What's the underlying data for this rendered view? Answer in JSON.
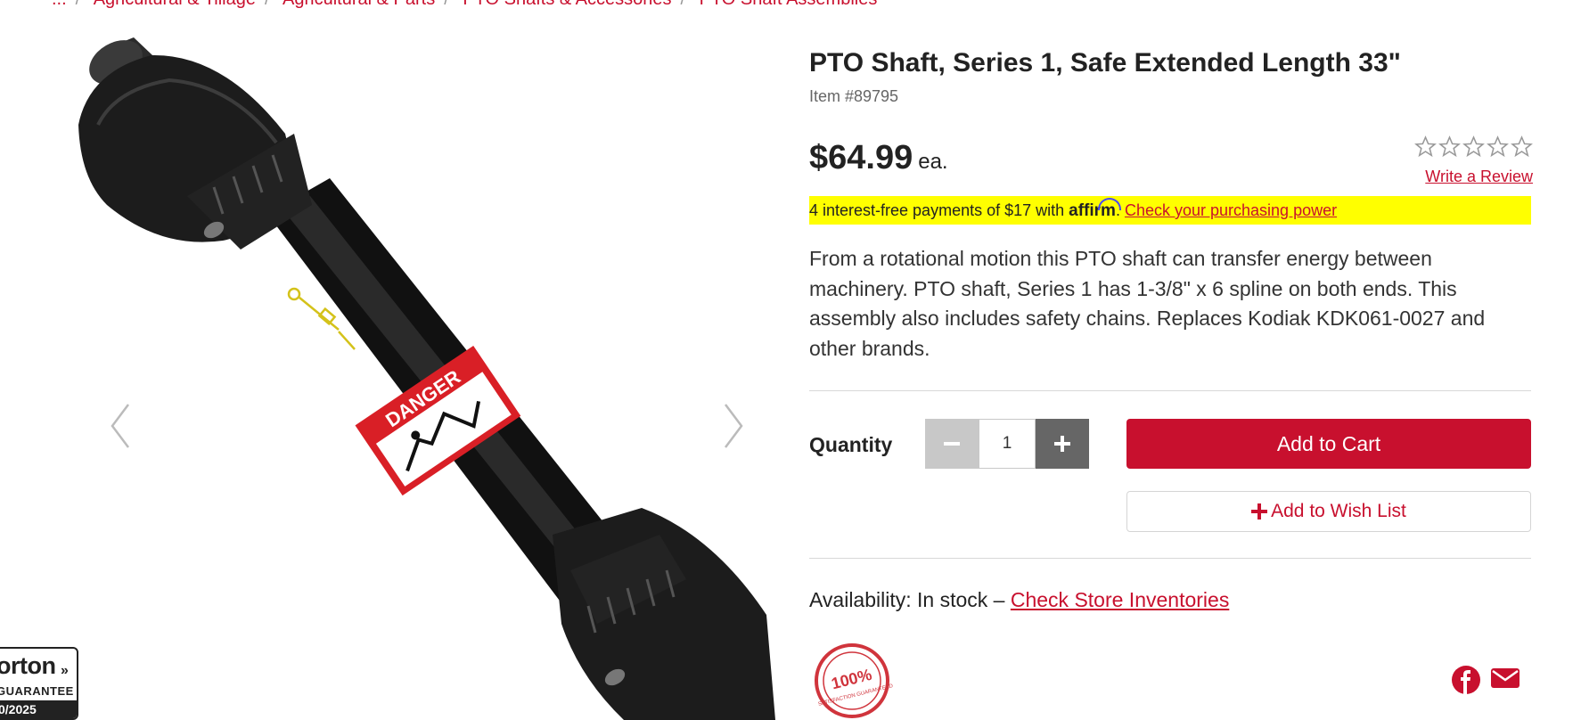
{
  "breadcrumb": {
    "items": [
      "...",
      "Agricultural & Tillage",
      "Agricultural & Parts",
      "PTO Shafts & Accessories",
      "PTO Shaft Assemblies"
    ]
  },
  "gallery": {
    "prev_icon": "chevron-left-icon",
    "next_icon": "chevron-right-icon",
    "label_danger": "DANGER"
  },
  "norton": {
    "brand": "orton",
    "guarantee": "GUARANTEE",
    "date": "0/2025"
  },
  "product": {
    "title": "PTO Shaft, Series 1, Safe Extended Length 33\"",
    "item_number": "Item #89795",
    "price": "$64.99",
    "unit": "ea.",
    "rating_stars": 0,
    "rating_max": 5,
    "write_review": "Write a Review",
    "description": "From a rotational motion this PTO shaft can transfer energy between machinery. PTO shaft, Series 1 has 1-3/8\" x 6 spline on both ends. This assembly also includes safety chains. Replaces Kodiak KDK061-0027 and other brands."
  },
  "affirm": {
    "text_pre": "4 interest-free payments of $17 with ",
    "logo": "affirm",
    "text_post": ". ",
    "link": "Check your purchasing power",
    "highlight_color": "#ffff00"
  },
  "purchase": {
    "quantity_label": "Quantity",
    "quantity_value": "1",
    "add_to_cart": "Add to Cart",
    "wishlist_icon": "plus-icon",
    "add_to_wishlist": "Add to Wish List"
  },
  "availability": {
    "label": "Availability: In stock – ",
    "link": "Check Store Inventories"
  },
  "seal": {
    "center_text": "100%",
    "arc_text": "SATISFACTION GUARANTEED"
  },
  "share": {
    "icons": [
      "facebook-icon",
      "email-icon"
    ]
  },
  "colors": {
    "brand_red": "#c8102e",
    "text_dark": "#222222",
    "gray_button": "#c8c8c8",
    "dark_button": "#666666"
  }
}
